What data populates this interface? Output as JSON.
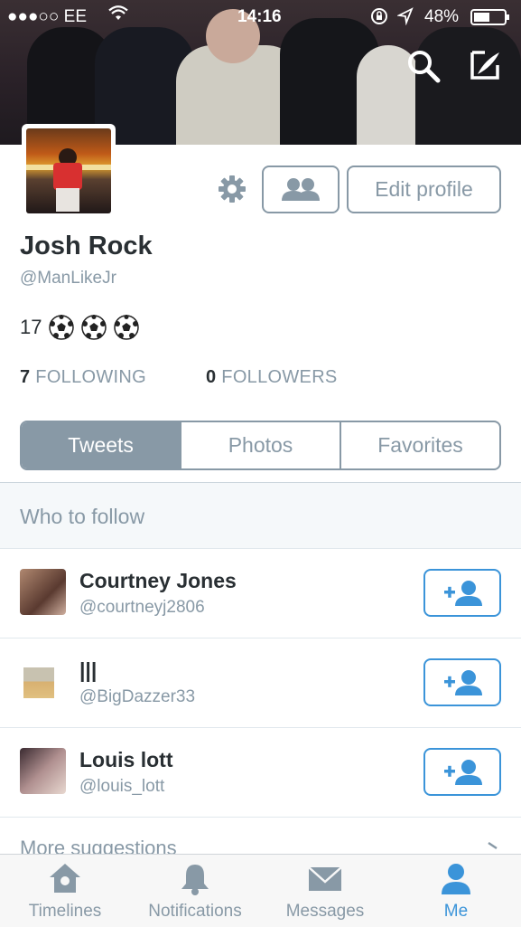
{
  "status_bar": {
    "carrier": "●●●○○ EE",
    "time": "14:16",
    "battery": "48%"
  },
  "profile": {
    "name": "Josh Rock",
    "handle": "@ManLikeJr",
    "bio_text": "17",
    "following_count": "7",
    "following_label": "FOLLOWING",
    "followers_count": "0",
    "followers_label": "FOLLOWERS",
    "edit_label": "Edit profile"
  },
  "tabs": [
    "Tweets",
    "Photos",
    "Favorites"
  ],
  "who_to_follow": {
    "title": "Who to follow",
    "users": [
      {
        "name": "Courtney Jones",
        "handle": "@courtneyj2806"
      },
      {
        "name": "|||",
        "handle": "@BigDazzer33"
      },
      {
        "name": "Louis lott",
        "handle": "@louis_lott"
      }
    ],
    "more": "More suggestions"
  },
  "tabbar": [
    {
      "label": "Timelines",
      "icon": "home-icon"
    },
    {
      "label": "Notifications",
      "icon": "bell-icon"
    },
    {
      "label": "Messages",
      "icon": "envelope-icon"
    },
    {
      "label": "Me",
      "icon": "person-icon"
    }
  ],
  "colors": {
    "accent": "#3b94d9",
    "gray": "#8899a6"
  }
}
